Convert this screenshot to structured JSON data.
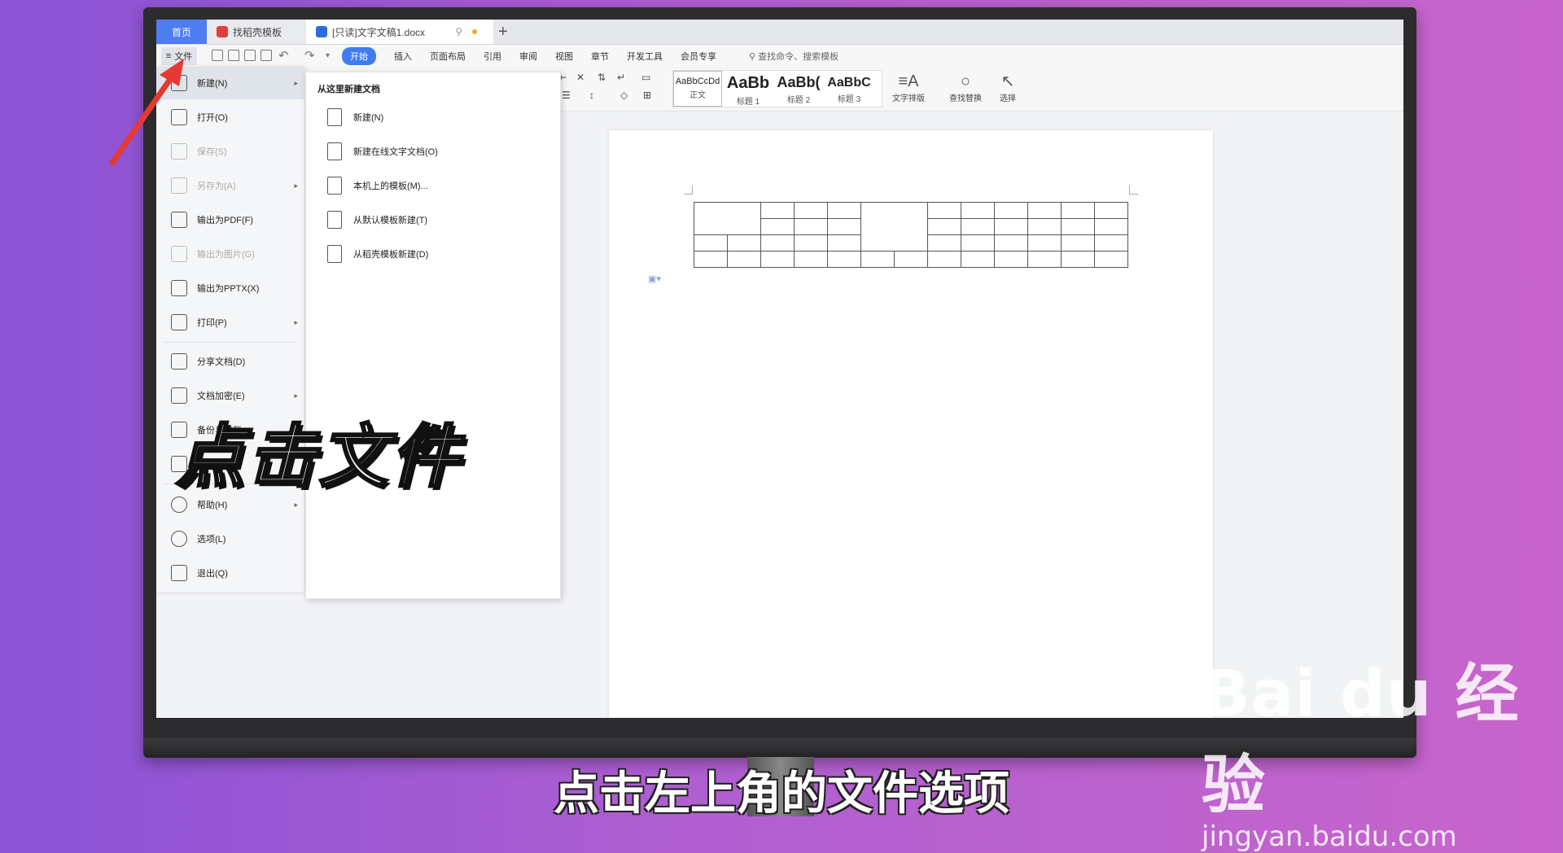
{
  "tabs": {
    "home": "首页",
    "template": "找稻壳模板",
    "document": "[只读]文字文稿1.docx",
    "add": "+"
  },
  "toolbar": {
    "file_label": "文件",
    "menu_tabs": [
      "开始",
      "插入",
      "页面布局",
      "引用",
      "审阅",
      "视图",
      "章节",
      "开发工具",
      "会员专享"
    ],
    "search_placeholder": "查找命令、搜索模板"
  },
  "ribbon": {
    "styles": [
      {
        "preview": "AaBbCcDd",
        "label": "正文"
      },
      {
        "preview": "AaBb",
        "label": "标题 1"
      },
      {
        "preview": "AaBb(",
        "label": "标题 2"
      },
      {
        "preview": "AaBbC",
        "label": "标题 3"
      }
    ],
    "text_layout": "文字排版",
    "find_replace": "查找替换",
    "select": "选择"
  },
  "file_menu": [
    {
      "label": "新建(N)",
      "icon": "new-doc-icon"
    },
    {
      "label": "打开(O)",
      "icon": "folder-open-icon"
    },
    {
      "label": "保存(S)",
      "icon": "save-icon"
    },
    {
      "label": "另存为(A)",
      "icon": "save-as-icon"
    },
    {
      "label": "输出为PDF(F)",
      "icon": "pdf-icon"
    },
    {
      "label": "输出为图片(G)",
      "icon": "image-icon"
    },
    {
      "label": "输出为PPTX(X)",
      "icon": "pptx-icon"
    },
    {
      "label": "打印(P)",
      "icon": "print-icon"
    },
    {
      "label": "分享文档(D)",
      "icon": "share-icon"
    },
    {
      "label": "文档加密(E)",
      "icon": "lock-icon"
    },
    {
      "label": "备份与恢复",
      "icon": "backup-icon"
    },
    {
      "label": "文档定稿",
      "icon": "finalize-icon"
    },
    {
      "label": "帮助(H)",
      "icon": "help-icon"
    },
    {
      "label": "选项(L)",
      "icon": "gear-icon"
    },
    {
      "label": "退出(Q)",
      "icon": "exit-icon"
    }
  ],
  "submenu": {
    "title": "从这里新建文档",
    "items": [
      "新建(N)",
      "新建在线文字文档(O)",
      "本机上的模板(M)...",
      "从默认模板新建(T)",
      "从稻壳模板新建(D)"
    ]
  },
  "overlay_text": "点击文件",
  "subtitle": "点击左上角的文件选项",
  "watermark": {
    "brand": "Bai du 经验",
    "url": "jingyan.baidu.com"
  },
  "colors": {
    "accent": "#3f7cf0",
    "arrow": "#e53935"
  }
}
